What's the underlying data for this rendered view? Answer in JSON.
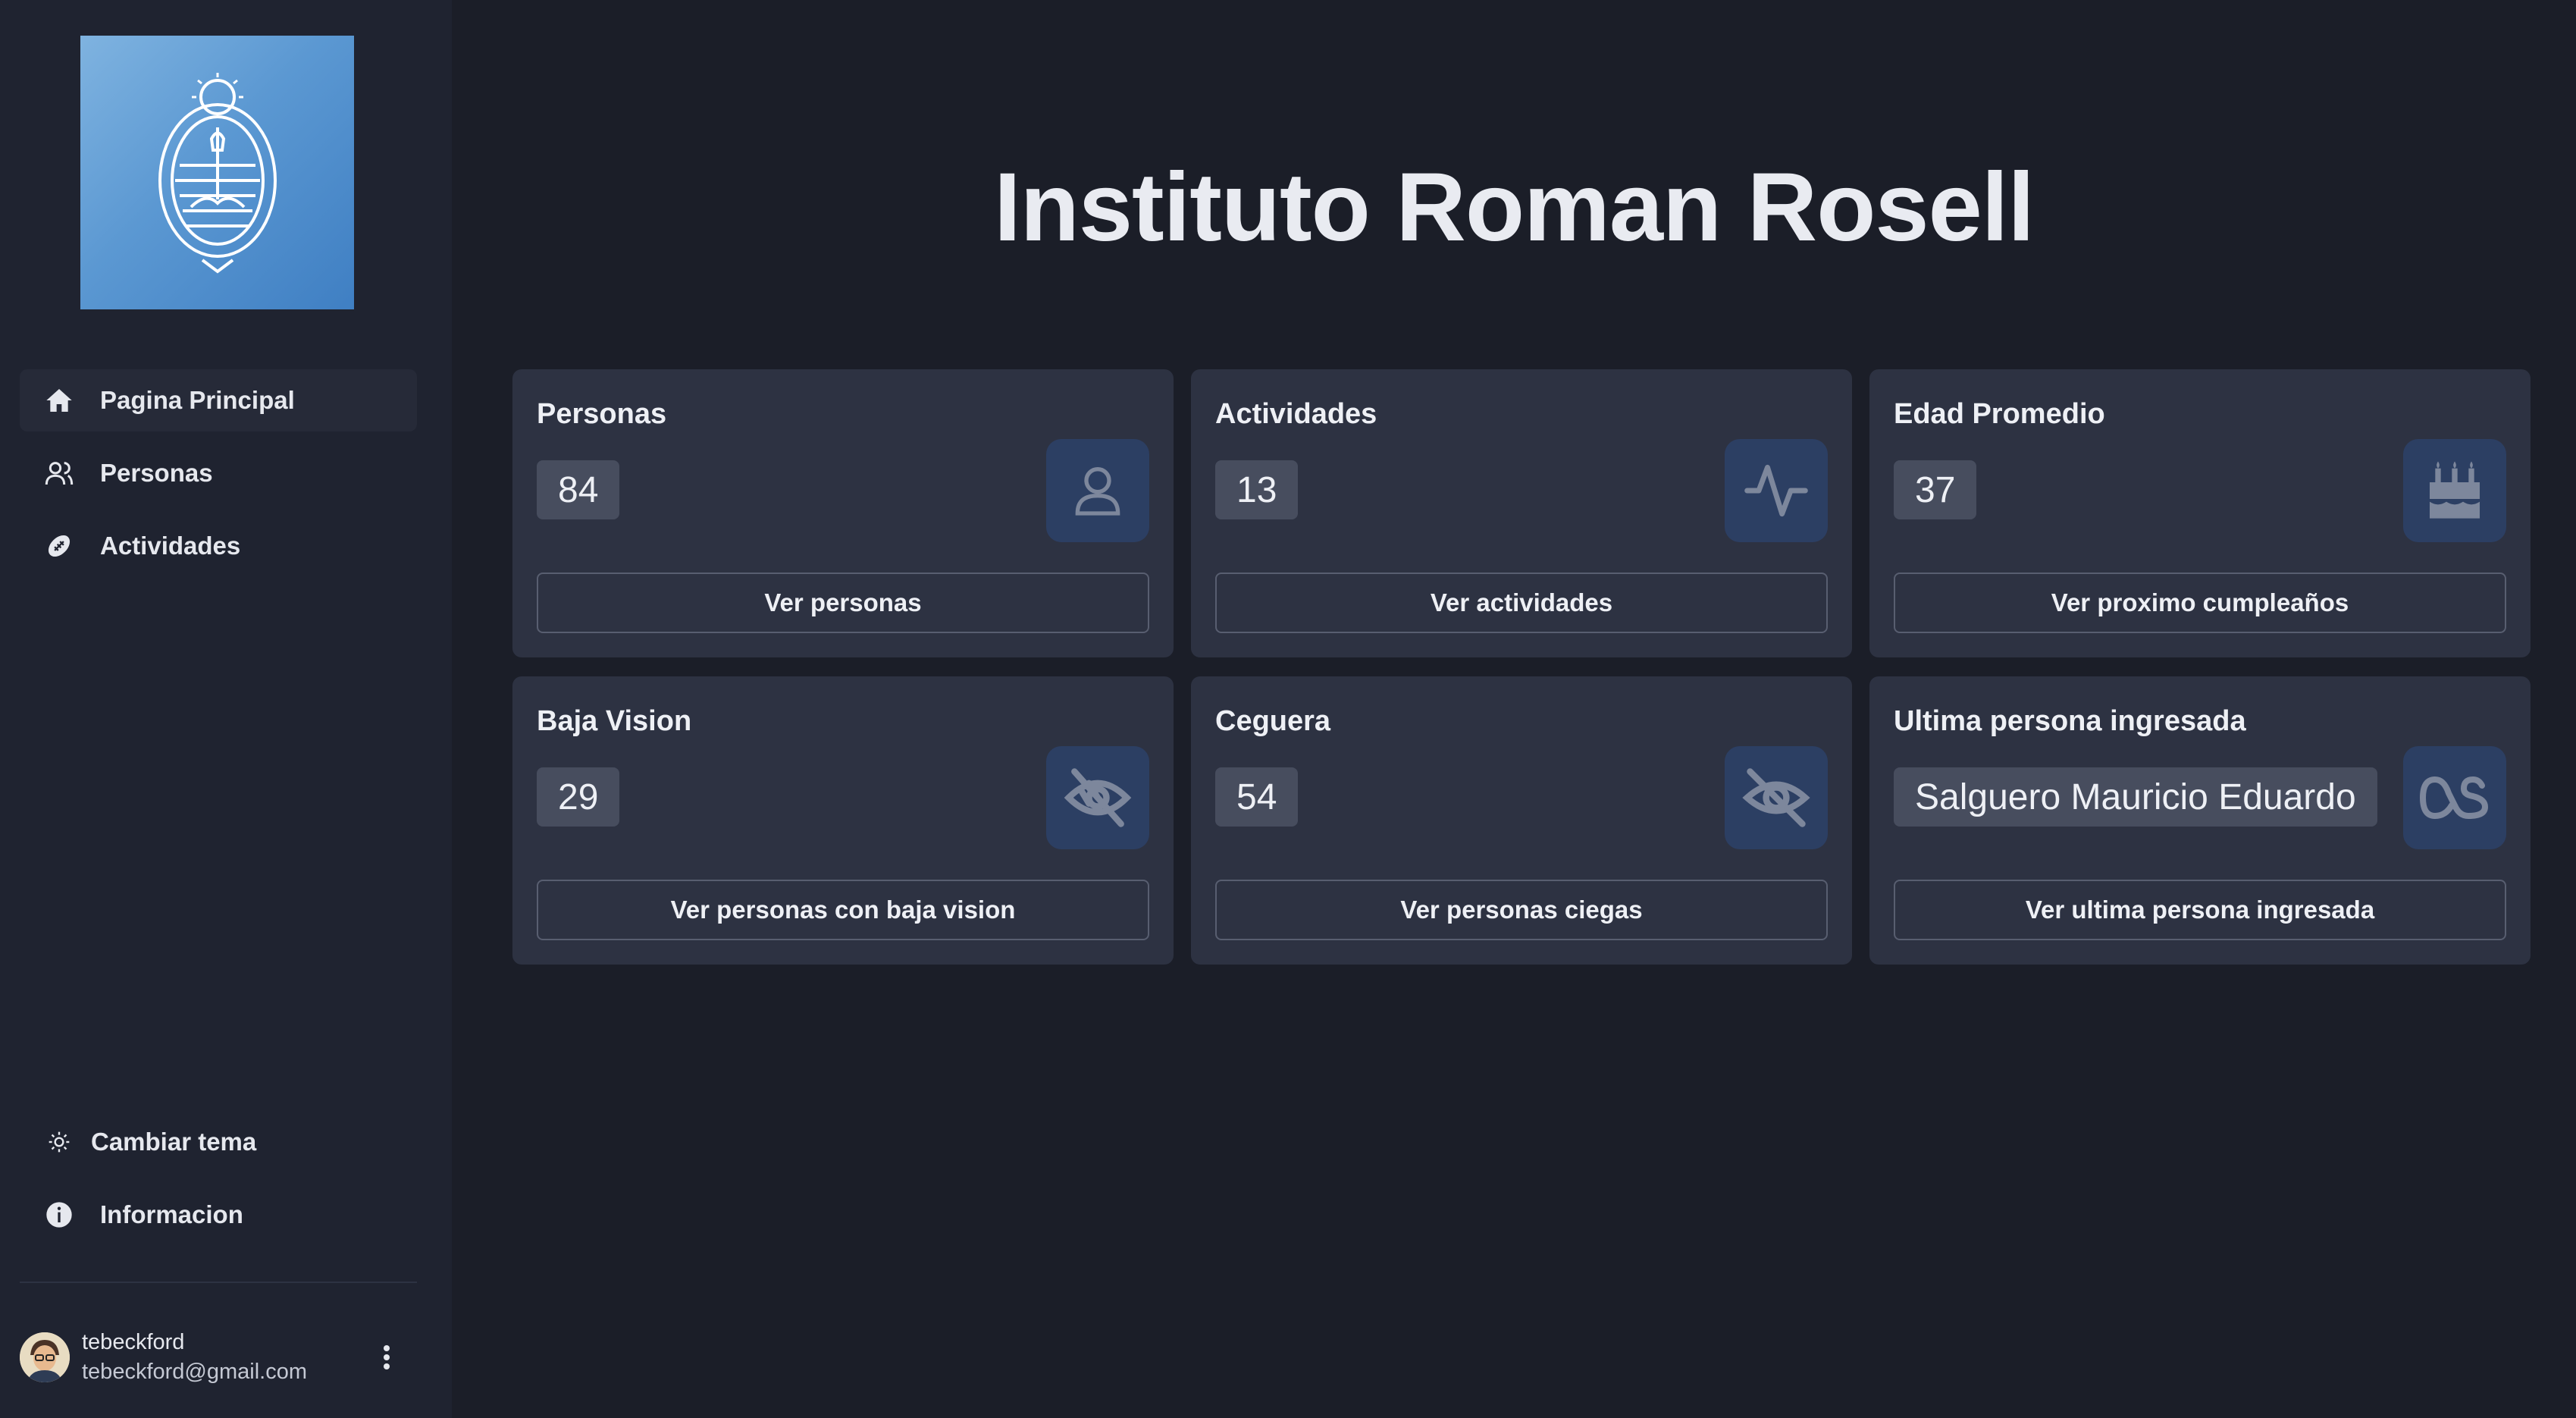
{
  "header": {
    "title": "Instituto Roman Rosell"
  },
  "sidebar": {
    "logo": "escudo-nacional-argentina",
    "nav": [
      {
        "label": "Pagina Principal",
        "icon": "home-icon",
        "active": true
      },
      {
        "label": "Personas",
        "icon": "users-icon",
        "active": false
      },
      {
        "label": "Actividades",
        "icon": "football-icon",
        "active": false
      }
    ],
    "bottom": [
      {
        "label": "Cambiar tema",
        "icon": "sun-icon"
      },
      {
        "label": "Informacion",
        "icon": "info-icon"
      }
    ],
    "user": {
      "name": "tebeckford",
      "email": "tebeckford@gmail.com"
    }
  },
  "cards": [
    {
      "title": "Personas",
      "value": "84",
      "icon": "user-icon",
      "button": "Ver personas"
    },
    {
      "title": "Actividades",
      "value": "13",
      "icon": "activity-icon",
      "button": "Ver actividades"
    },
    {
      "title": "Edad Promedio",
      "value": "37",
      "icon": "cake-icon",
      "button": "Ver proximo cumpleaños"
    },
    {
      "title": "Baja Vision",
      "value": "29",
      "icon": "low-vision-icon",
      "button": "Ver personas con baja vision"
    },
    {
      "title": "Ceguera",
      "value": "54",
      "icon": "eye-off-icon",
      "button": "Ver personas ciegas"
    },
    {
      "title": "Ultima persona ingresada",
      "value": "Salguero Mauricio Eduardo",
      "icon": "lastfm-icon",
      "button": "Ver ultima persona ingresada"
    }
  ],
  "colors": {
    "background": "#1b1e28",
    "sidebar": "#1f2330",
    "card": "#2d3242",
    "icon_tile": "#2c3f63",
    "icon_glyph": "#7d879c"
  }
}
